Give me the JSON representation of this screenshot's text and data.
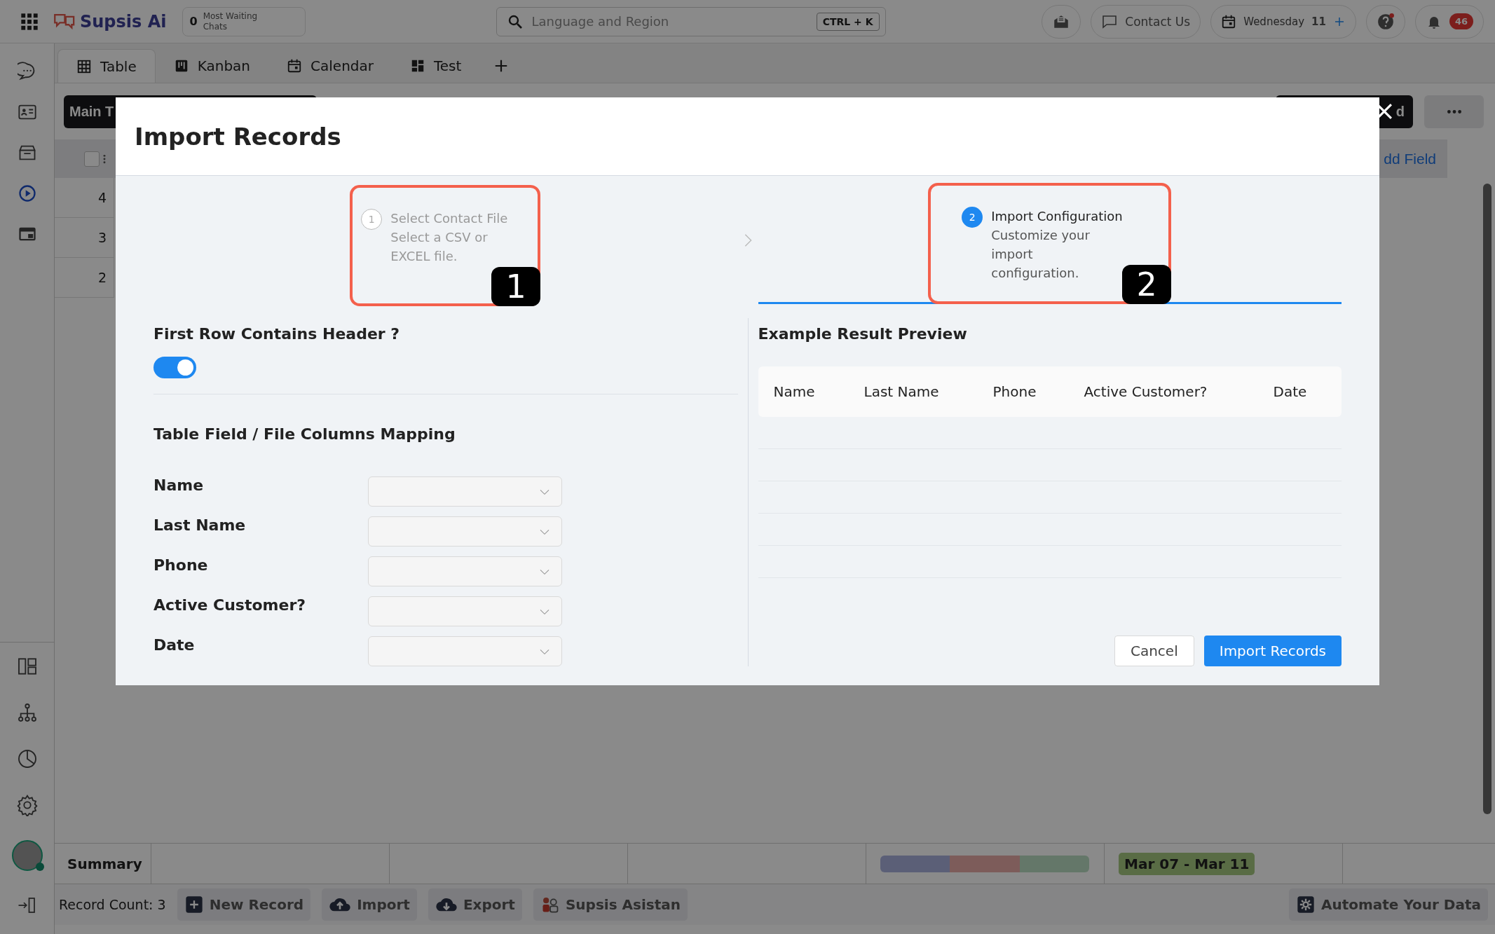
{
  "topbar": {
    "logo": "Supsis Ai",
    "waiting": {
      "count": "0",
      "label": "Most Waiting Chats"
    },
    "search": {
      "placeholder": "Language and Region",
      "shortcut": "CTRL + K"
    },
    "contact": "Contact Us",
    "date": {
      "day": "Wednesday",
      "number": "11"
    },
    "notifications": "46"
  },
  "tabs": [
    {
      "label": "Table",
      "selected": true
    },
    {
      "label": "Kanban",
      "selected": false
    },
    {
      "label": "Calendar",
      "selected": false
    },
    {
      "label": "Test",
      "selected": false
    }
  ],
  "toolbar": {
    "view": "Main T",
    "record_button": "d"
  },
  "table": {
    "add_field": "dd Field",
    "select_all_checked": false,
    "rows": [
      "4",
      "3",
      "2"
    ]
  },
  "summary": {
    "label": "Summary",
    "date_range": "Mar 07 - Mar 11"
  },
  "footer": {
    "record_count": "Record Count: 3",
    "actions": [
      "New Record",
      "Import",
      "Export",
      "Supsis Asistan"
    ],
    "automate": "Automate Your Data"
  },
  "modal": {
    "title": "Import Records",
    "steps": [
      {
        "number": "1",
        "title": "Select Contact File",
        "description": "Select a CSV or EXCEL file.",
        "selected": false,
        "annotation": "1"
      },
      {
        "number": "2",
        "title": "Import Configuration",
        "description": "Customize your import configuration.",
        "selected": true,
        "annotation": "2"
      }
    ],
    "header_toggle": {
      "label": "First Row Contains Header ?",
      "on": true
    },
    "mapping_title": "Table Field / File Columns Mapping",
    "fields": [
      "Name",
      "Last Name",
      "Phone",
      "Active Customer?",
      "Date"
    ],
    "preview": {
      "title": "Example Result Preview",
      "columns": [
        "Name",
        "Last Name",
        "Phone",
        "Active Customer?",
        "Date"
      ]
    },
    "buttons": {
      "cancel": "Cancel",
      "submit": "Import Records"
    }
  }
}
